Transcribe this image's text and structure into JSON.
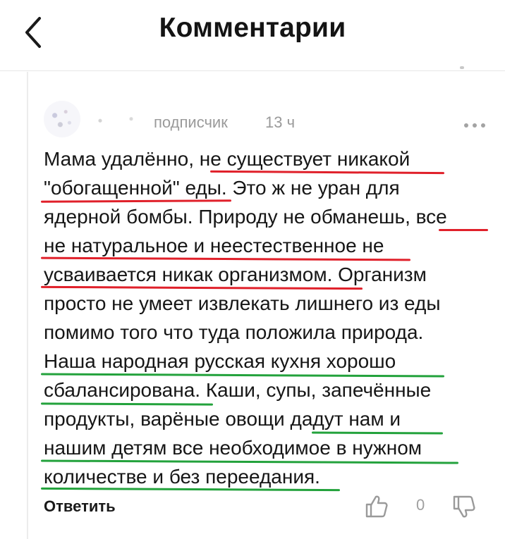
{
  "header": {
    "title": "Комментарии",
    "back_icon": "chevron-left-icon"
  },
  "comment": {
    "author_role": "подписчик",
    "time": "13 ч",
    "more_icon": "more-horizontal-icon",
    "lines": [
      "Мама удалённо, не существует никакой",
      "\"обогащенной\" еды. Это ж не уран для",
      "ядерной бомбы. Природу не обманешь, все",
      "не натуральное и неестественное не",
      "усваивается никак организмом. Организм",
      "просто не умеет извлекать лишнего из еды",
      "помимо того что туда положила природа.",
      "Наша народная русская кухня хорошо",
      "сбалансирована. Каши, супы, запечённые",
      "продукты, варёные овощи дадут нам и",
      "нашим детям все необходимое в нужном",
      "количестве и без переедания."
    ],
    "underline_colors": {
      "red": "#e0202a",
      "green": "#23a23c"
    }
  },
  "actions": {
    "reply_label": "Ответить",
    "like_icon": "thumbs-up-icon",
    "like_count": "0",
    "dislike_icon": "thumbs-down-icon"
  }
}
